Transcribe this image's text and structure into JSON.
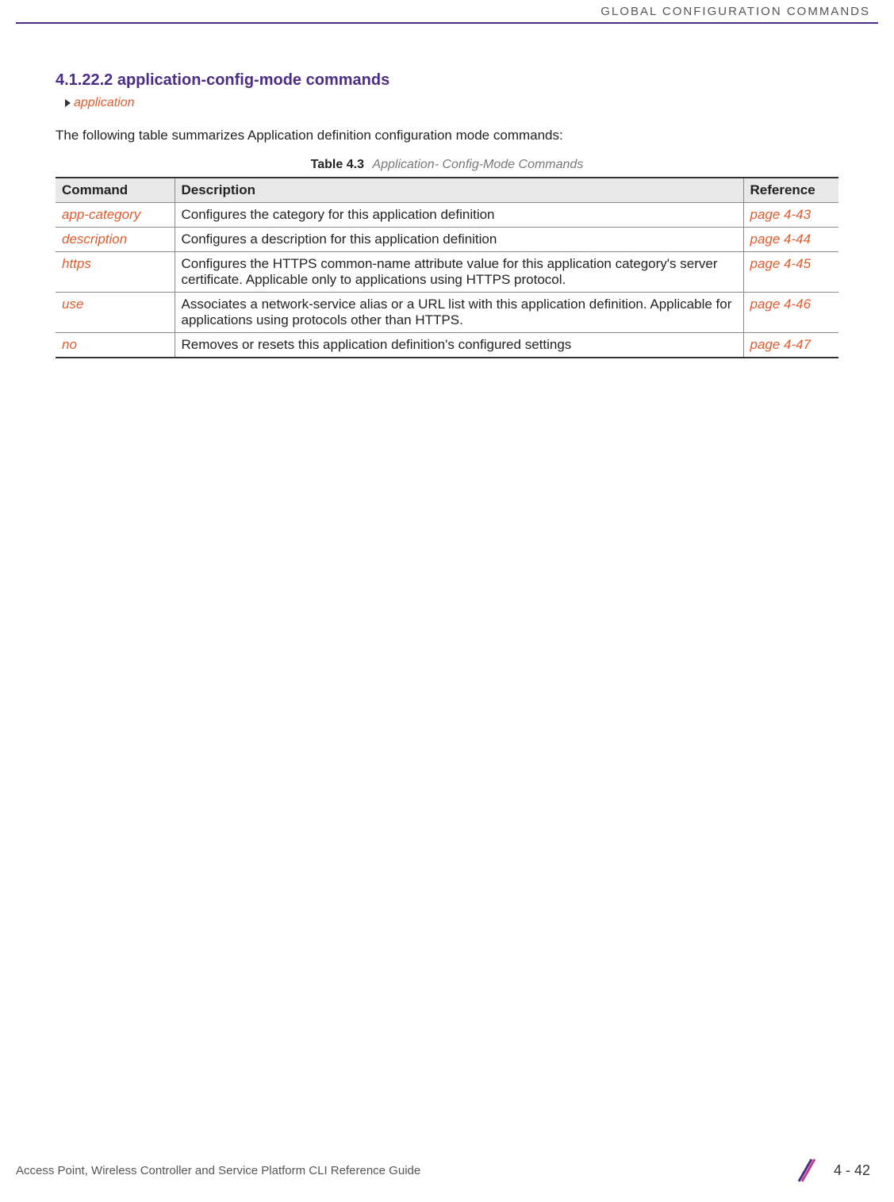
{
  "header": {
    "title": "GLOBAL CONFIGURATION COMMANDS"
  },
  "section": {
    "heading": "4.1.22.2 application-config-mode commands",
    "application_link": "application",
    "intro": "The following table summarizes Application definition configuration mode commands:"
  },
  "table": {
    "caption_label": "Table 4.3",
    "caption_title": "Application- Config-Mode Commands",
    "headers": {
      "command": "Command",
      "description": "Description",
      "reference": "Reference"
    },
    "rows": [
      {
        "command": "app-category",
        "description": "Configures the category for this application definition",
        "reference": "page 4-43"
      },
      {
        "command": "description",
        "description": "Configures a description for this application definition",
        "reference": "page 4-44"
      },
      {
        "command": "https",
        "description": "Configures the HTTPS common-name attribute value for this application category's server certificate. Applicable only to applications using HTTPS protocol.",
        "reference": "page 4-45"
      },
      {
        "command": "use",
        "description": "Associates a network-service alias or a URL list with this application definition. Applicable for applications using protocols other than HTTPS.",
        "reference": "page 4-46"
      },
      {
        "command": "no",
        "description": "Removes or resets this application definition's configured settings",
        "reference": "page 4-47"
      }
    ]
  },
  "footer": {
    "guide": "Access Point, Wireless Controller and Service Platform CLI Reference Guide",
    "page": "4 - 42"
  }
}
